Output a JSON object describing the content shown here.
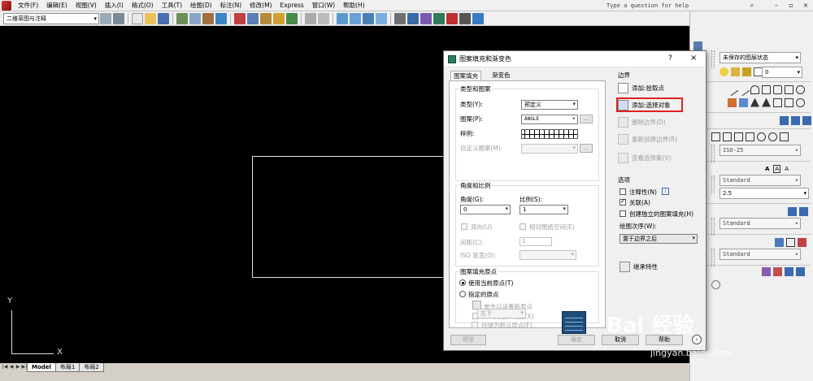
{
  "menubar": {
    "items": [
      "文件(F)",
      "编辑(E)",
      "视图(V)",
      "插入(I)",
      "格式(O)",
      "工具(T)",
      "绘图(D)",
      "标注(N)",
      "修改(M)",
      "Express",
      "窗口(W)",
      "帮助(H)"
    ],
    "help_placeholder": "Type a question for help"
  },
  "toolbar": {
    "workspace": "二维草图与注释"
  },
  "canvas": {
    "ucs_x": "X",
    "ucs_y": "Y",
    "tabs": [
      "Model",
      "布局1",
      "布局2"
    ]
  },
  "right_panel": {
    "layer_state": "未保存的图层状态",
    "layer_value": "0",
    "dim_style": "ISO-25",
    "text_style": "Standard",
    "text_height": "2.5",
    "mleader_style": "Standard",
    "table_style": "Standard"
  },
  "dialog": {
    "title": "图案填充和渐变色",
    "help": "?",
    "close": "×",
    "tabs": [
      "图案填充",
      "渐变色"
    ],
    "type_pattern": {
      "group_label": "类型和图案",
      "type_label": "类型(Y):",
      "type_value": "预定义",
      "pattern_label": "图案(P):",
      "pattern_value": "ANGLE",
      "more_btn": "...",
      "swatch_label": "样例:",
      "custom_label": "自定义图案(M):"
    },
    "angle_scale": {
      "group_label": "角度和比例",
      "angle_label": "角度(G):",
      "angle_value": "0",
      "scale_label": "比例(S):",
      "scale_value": "1",
      "double_label": "双向(U)",
      "relative_label": "相对图纸空间(E)",
      "spacing_label": "间距(C):",
      "spacing_value": "1",
      "iso_label": "ISO 笔宽(O):"
    },
    "origin": {
      "group_label": "图案填充原点",
      "use_current": "使用当前原点(T)",
      "specified": "指定的原点",
      "click_set": "单击以设置新原点",
      "default_extents": "默认为边界范围(X)",
      "position": "左下",
      "store_default": "存储为默认原点(F)"
    },
    "boundary": {
      "label": "边界",
      "add_pick": "添加:拾取点",
      "add_select": "添加:选择对象",
      "remove": "删除边界(D)",
      "recreate": "重新创建边界(R)",
      "view": "查看选择集(V)"
    },
    "options": {
      "label": "选项",
      "annotative": "注释性(N)",
      "associative": "关联(A)",
      "independent": "创建独立的图案填充(H)",
      "draw_order_label": "绘图次序(W):",
      "draw_order_value": "置于边界之后"
    },
    "inherit": "继承特性",
    "buttons": {
      "preview": "预览",
      "ok": "确定",
      "cancel": "取消",
      "help": "帮助"
    },
    "expand": "›"
  },
  "watermark": {
    "main": "Bai 经验",
    "sub": "jingyan.baidu.com"
  }
}
